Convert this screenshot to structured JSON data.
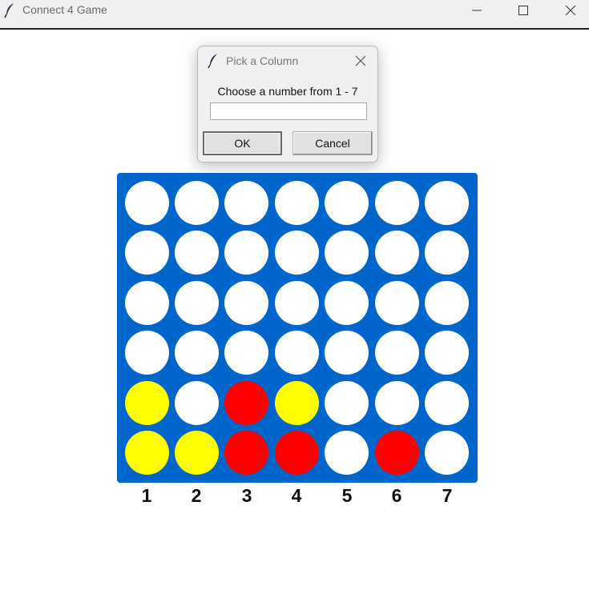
{
  "window": {
    "title": "Connect 4 Game",
    "icon": "feather-icon",
    "controls": [
      "minimize-icon",
      "maximize-icon",
      "close-icon"
    ]
  },
  "dialog": {
    "title": "Pick a Column",
    "prompt": "Choose a number from 1 - 7",
    "input_value": "",
    "ok_label": "OK",
    "cancel_label": "Cancel"
  },
  "board": {
    "rows": 6,
    "columns": 7,
    "column_labels": [
      "1",
      "2",
      "3",
      "4",
      "5",
      "6",
      "7"
    ],
    "grid": [
      [
        "empty",
        "empty",
        "empty",
        "empty",
        "empty",
        "empty",
        "empty"
      ],
      [
        "empty",
        "empty",
        "empty",
        "empty",
        "empty",
        "empty",
        "empty"
      ],
      [
        "empty",
        "empty",
        "empty",
        "empty",
        "empty",
        "empty",
        "empty"
      ],
      [
        "empty",
        "empty",
        "empty",
        "empty",
        "empty",
        "empty",
        "empty"
      ],
      [
        "yellow",
        "empty",
        "red",
        "yellow",
        "empty",
        "empty",
        "empty"
      ],
      [
        "yellow",
        "yellow",
        "red",
        "red",
        "empty",
        "red",
        "empty"
      ]
    ]
  },
  "colors": {
    "board": "#0066cc",
    "empty": "#ffffff",
    "red": "#ff0000",
    "yellow": "#ffff00"
  }
}
